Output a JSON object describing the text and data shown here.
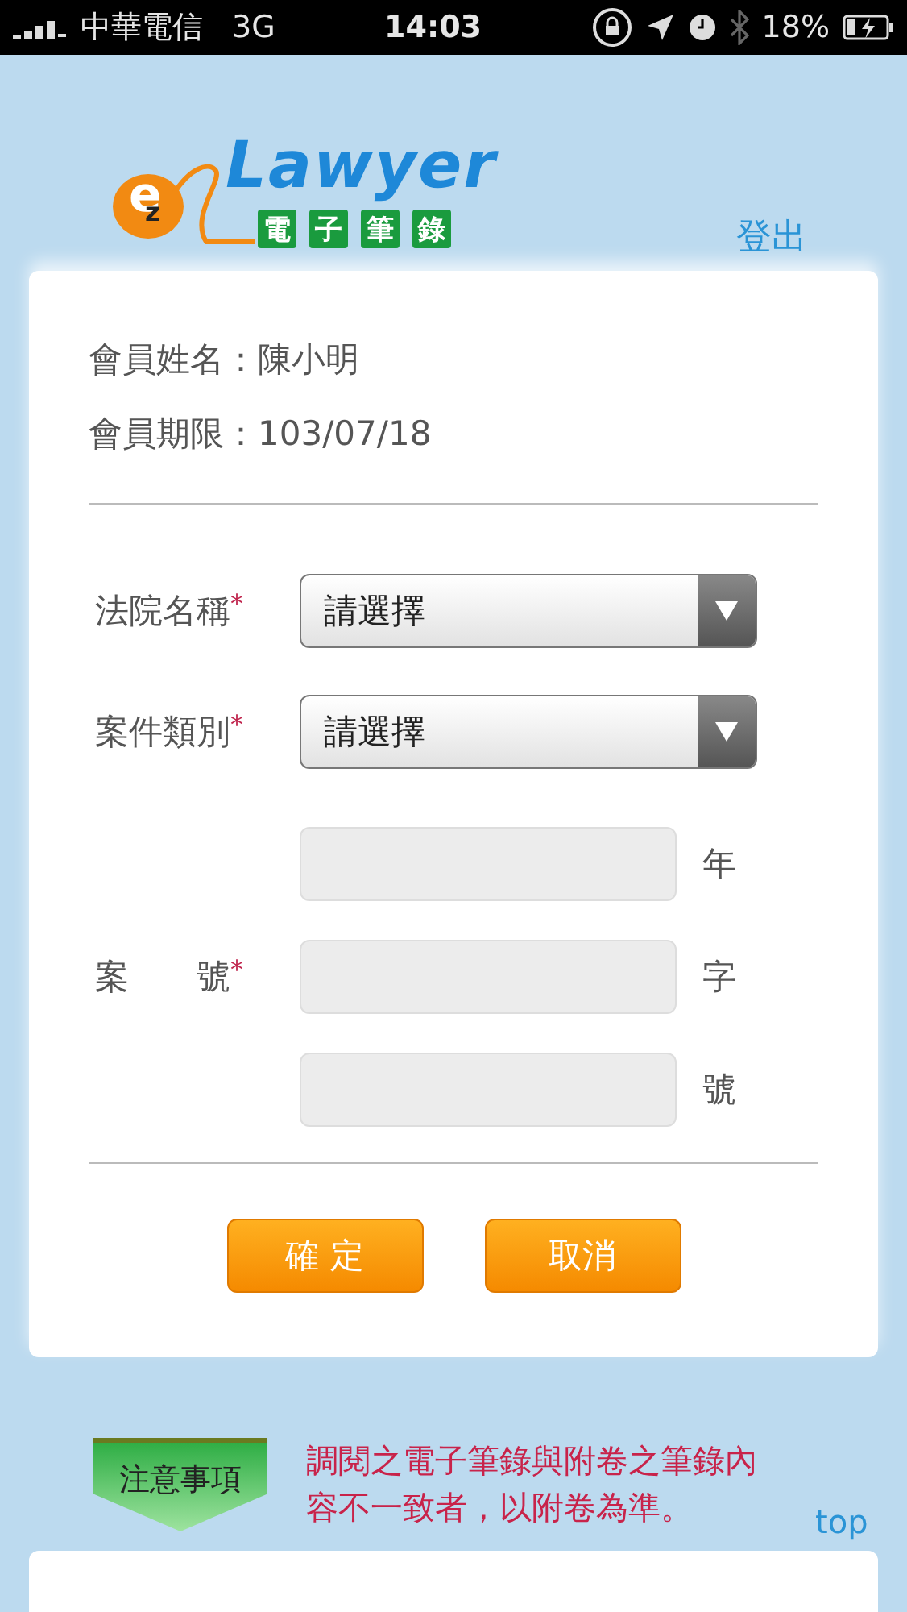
{
  "status_bar": {
    "carrier": "中華電信",
    "network": "3G",
    "time": "14:03",
    "battery": "18%"
  },
  "logo": {
    "letter_big": "e",
    "letter_small": "z",
    "title": "Lawyer",
    "subtitle_chars": [
      "電",
      "子",
      "筆",
      "錄"
    ]
  },
  "logout_link": "登出",
  "member": [
    {
      "label": "會員姓名：",
      "value": "陳小明"
    },
    {
      "label": "會員期限：",
      "value": "103/07/18"
    }
  ],
  "selects": [
    {
      "label": "法院名稱",
      "required_mark": "*",
      "value": "請選擇"
    },
    {
      "label": "案件類別",
      "required_mark": "*",
      "value": "請選擇"
    }
  ],
  "case_number": {
    "label": "案　　號",
    "required_mark": "*",
    "inputs": [
      {
        "suffix": "年"
      },
      {
        "suffix": "字"
      },
      {
        "suffix": "號"
      }
    ]
  },
  "buttons": [
    "確 定",
    "取消"
  ],
  "notice": {
    "badge": "注意事項",
    "text": "調閱之電子筆錄與附卷之筆錄內容不一致者，以附卷為準。"
  },
  "top_link": "top"
}
